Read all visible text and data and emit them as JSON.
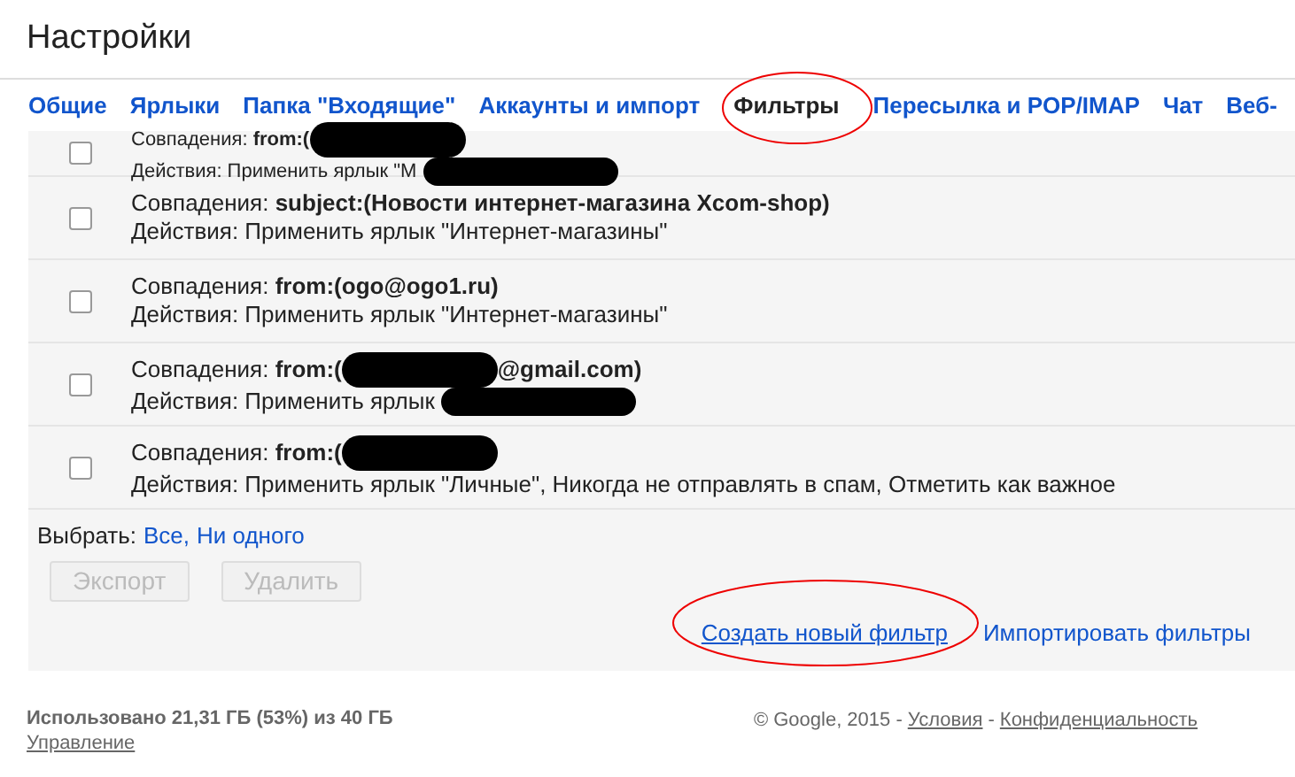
{
  "page_title": "Настройки",
  "tabs": [
    {
      "label": "Общие",
      "selected": false
    },
    {
      "label": "Ярлыки",
      "selected": false
    },
    {
      "label": "Папка \"Входящие\"",
      "selected": false
    },
    {
      "label": "Аккаунты и импорт",
      "selected": false
    },
    {
      "label": "Фильтры",
      "selected": true
    },
    {
      "label": "Пересылка и POP/IMAP",
      "selected": false
    },
    {
      "label": "Чат",
      "selected": false
    },
    {
      "label": "Веб-",
      "selected": false
    }
  ],
  "filters": [
    {
      "match_label": "Совпадения:",
      "match": "from:(",
      "action": "Действия: Применить ярлык \"М",
      "checked": false,
      "redacted": true
    },
    {
      "match_label": "Совпадения:",
      "match": "subject:(Новости интернет-магазина Xcom-shop)",
      "action": "Действия: Применить ярлык \"Интернет-магазины\"",
      "checked": false,
      "redacted": false
    },
    {
      "match_label": "Совпадения:",
      "match": "from:(ogo@ogo1.ru)",
      "action": "Действия: Применить ярлык \"Интернет-магазины\"",
      "checked": false,
      "redacted": false
    },
    {
      "match_label": "Совпадения:",
      "match": "from:(",
      "match_tail": "@gmail.com)",
      "action": "Действия: Применить ярлык",
      "checked": false,
      "redacted": true
    },
    {
      "match_label": "Совпадения:",
      "match": "from:(",
      "action": "Действия: Применить ярлык \"Личные\", Никогда не отправлять в спам, Отметить как важное",
      "checked": false,
      "redacted": true
    }
  ],
  "select": {
    "label": "Выбрать:",
    "links": [
      "Все,",
      "Ни одного"
    ]
  },
  "buttons": [
    {
      "label": "Экспорт",
      "disabled": true
    },
    {
      "label": "Удалить",
      "disabled": true
    }
  ],
  "links": [
    "Создать новый фильтр",
    "Импортировать фильтры"
  ],
  "footer": {
    "usage": "Использовано 21,31 ГБ (53%) из 40 ГБ",
    "manage": "Управление",
    "copyright": "© Google, 2015 -",
    "terms": "Условия",
    "separator": "-",
    "privacy": "Конфиденциальность"
  }
}
